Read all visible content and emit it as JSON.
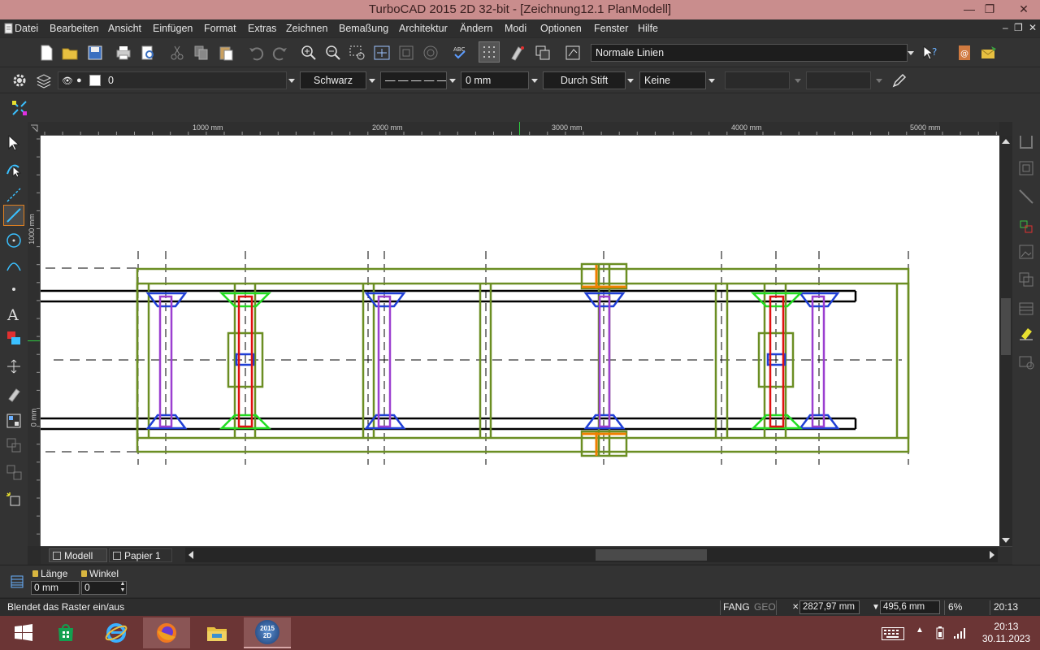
{
  "window": {
    "title": "TurboCAD 2015 2D 32-bit - [Zeichnung12.1 PlanModell]",
    "minimize": "—",
    "maximize": "❐",
    "close": "✕"
  },
  "menu": {
    "items": [
      "Datei",
      "Bearbeiten",
      "Ansicht",
      "Einfügen",
      "Format",
      "Extras",
      "Zeichnen",
      "Bemaßung",
      "Architektur",
      "Ändern",
      "Modi",
      "Optionen",
      "Fenster",
      "Hilfe"
    ],
    "mdi_minimize": "–",
    "mdi_restore": "❐",
    "mdi_close": "✕"
  },
  "toolbar": {
    "linestyle_preset": "Normale Linien"
  },
  "properties": {
    "layer": "0",
    "color": "Schwarz",
    "linetype": "— — — — —",
    "width": "0 mm",
    "pen": "Durch Stift",
    "fill": "Keine"
  },
  "ruler": {
    "h_labels": [
      "1000 mm",
      "2000 mm",
      "3000 mm",
      "4000 mm",
      "5000 mm"
    ],
    "v_labels": [
      "1000 mm",
      "0 mm"
    ]
  },
  "tabs": [
    "Modell",
    "Papier 1"
  ],
  "inspector": {
    "length_label": "Länge",
    "length_value": "0 mm",
    "angle_label": "Winkel",
    "angle_value": "0"
  },
  "status": {
    "message": "Blendet das Raster ein/aus",
    "snap": "FANG",
    "geo": "GEO",
    "x": "2827,97 mm",
    "y": "495,6 mm",
    "zoom": "6%",
    "time": "20:13"
  },
  "taskbar": {
    "time": "20:13",
    "date": "30.11.2023",
    "app_badge": "2015 2D"
  },
  "colors": {
    "titlebar": "#c98d8d",
    "taskbar": "#6b3535",
    "frame": "#6b8e23",
    "blue": "#1f3fd6",
    "purple": "#9b3fd0",
    "green": "#22dd22",
    "red": "#e01010",
    "orange": "#f08000"
  }
}
